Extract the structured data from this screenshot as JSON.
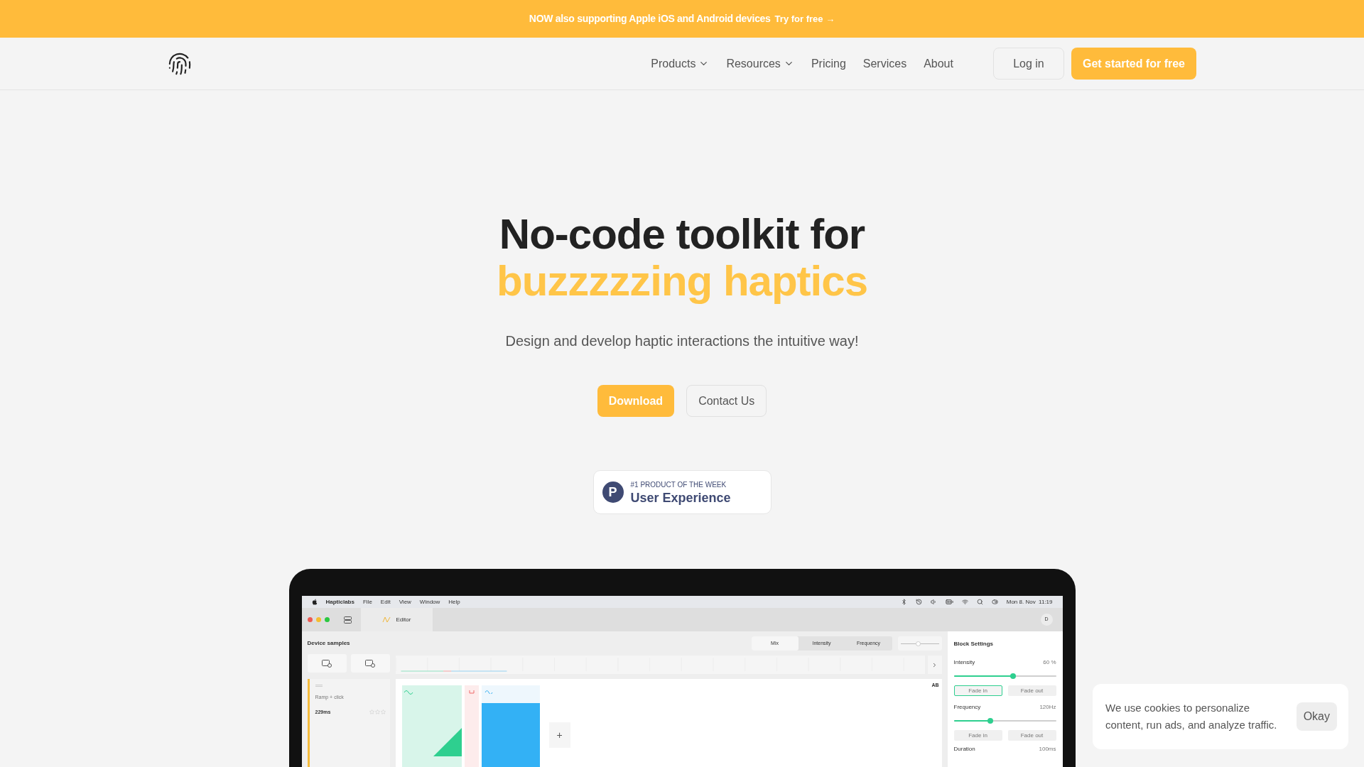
{
  "banner": {
    "text": "NOW also supporting Apple iOS and Android devices",
    "link": "Try for free →"
  },
  "nav": {
    "links": [
      {
        "label": "Products",
        "dropdown": true
      },
      {
        "label": "Resources",
        "dropdown": true
      },
      {
        "label": "Pricing",
        "dropdown": false
      },
      {
        "label": "Services",
        "dropdown": false
      },
      {
        "label": "About",
        "dropdown": false
      }
    ],
    "login": "Log in",
    "cta": "Get started for free"
  },
  "hero": {
    "title": "No-code toolkit for",
    "highlight": "buzzzzzing haptics",
    "subtitle": "Design and develop haptic interactions the intuitive way!",
    "buttons": [
      {
        "label": "Download",
        "kind": "primary"
      },
      {
        "label": "Contact Us",
        "kind": "secondary"
      }
    ]
  },
  "badge": {
    "letter": "P",
    "eyebrow": "#1 PRODUCT OF THE WEEK",
    "title": "User Experience"
  },
  "app": {
    "menubar": {
      "app_name": "Hapticlabs",
      "menus": [
        "File",
        "Edit",
        "View",
        "Window",
        "Help"
      ],
      "clock": "Mon 8. Nov  11:19"
    },
    "tab": "Editor",
    "avatar": "D",
    "sidebar": {
      "title": "Device samples",
      "sample": {
        "name": "Ramp + click",
        "duration": "229ms",
        "stars": 0
      }
    },
    "view_modes": [
      {
        "label": "Mix",
        "selected": true
      },
      {
        "label": "Intensity",
        "selected": false
      },
      {
        "label": "Frequency",
        "selected": false
      }
    ],
    "zoom": {
      "level": 0.45
    },
    "canvas_label": "AB",
    "add_button": "+",
    "settings": {
      "title": "Block Settings",
      "intensity": {
        "label": "Intensity",
        "reading": "60 %",
        "level": 0.58
      },
      "fades_1": [
        {
          "label": "Fade in",
          "selected": true
        },
        {
          "label": "Fade out",
          "selected": false
        }
      ],
      "frequency": {
        "label": "Frequency",
        "reading": "120Hz",
        "level": 0.36
      },
      "fades_2": [
        {
          "label": "Fade in",
          "selected": false
        },
        {
          "label": "Fade out",
          "selected": false
        }
      ],
      "duration": {
        "label": "Duration",
        "reading": "100ms"
      }
    }
  },
  "cookie": {
    "text": "We use cookies to personalize content, run ads, and analyze traffic.",
    "button": "Okay"
  }
}
